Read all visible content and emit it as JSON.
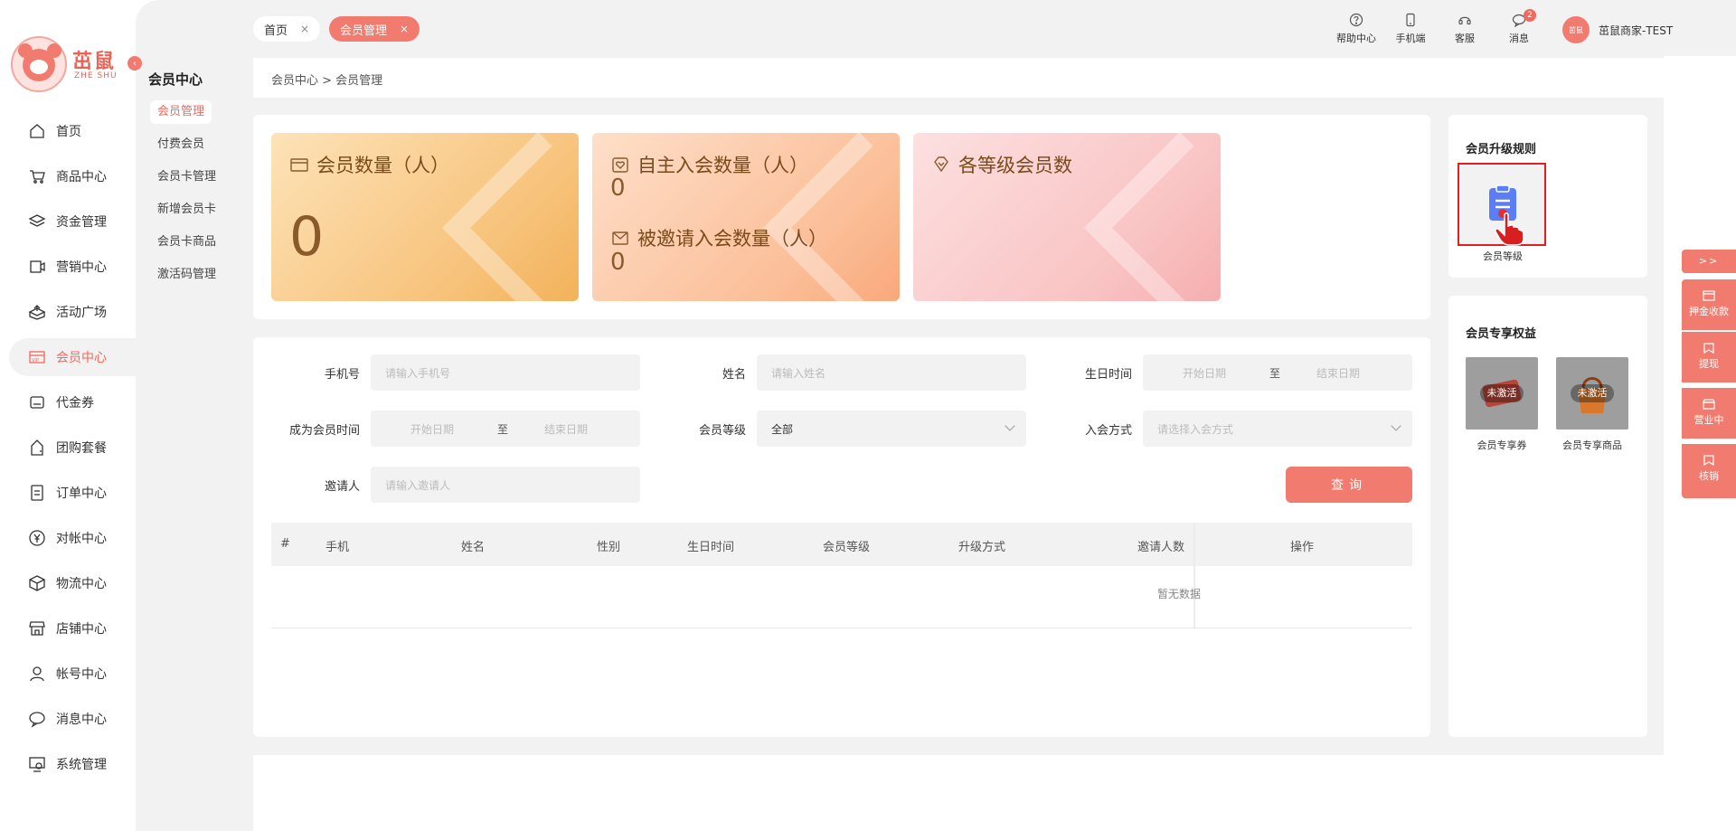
{
  "brand": {
    "name": "茁鼠",
    "sub": "ZHE SHU"
  },
  "nav": [
    {
      "label": "首页",
      "icon": "home-icon"
    },
    {
      "label": "商品中心",
      "icon": "cart-icon"
    },
    {
      "label": "资金管理",
      "icon": "layers-icon"
    },
    {
      "label": "营销中心",
      "icon": "marketing-icon"
    },
    {
      "label": "活动广场",
      "icon": "activity-icon"
    },
    {
      "label": "会员中心",
      "icon": "vip-icon",
      "active": true
    },
    {
      "label": "代金券",
      "icon": "coupon-icon"
    },
    {
      "label": "团购套餐",
      "icon": "group-buy-icon"
    },
    {
      "label": "订单中心",
      "icon": "order-icon"
    },
    {
      "label": "对帐中心",
      "icon": "yen-icon"
    },
    {
      "label": "物流中心",
      "icon": "box-icon"
    },
    {
      "label": "店铺中心",
      "icon": "store-icon"
    },
    {
      "label": "帐号中心",
      "icon": "user-icon"
    },
    {
      "label": "消息中心",
      "icon": "message-icon"
    },
    {
      "label": "系统管理",
      "icon": "system-icon"
    }
  ],
  "subnav": {
    "title": "会员中心",
    "items": [
      "会员管理",
      "付费会员",
      "会员卡管理",
      "新增会员卡",
      "会员卡商品",
      "激活码管理"
    ]
  },
  "tabs": [
    {
      "label": "首页",
      "close": "×"
    },
    {
      "label": "会员管理",
      "close": "×"
    }
  ],
  "toolbar": [
    {
      "label": "帮助中心",
      "icon": "help-icon"
    },
    {
      "label": "手机端",
      "icon": "mobile-icon"
    },
    {
      "label": "客服",
      "icon": "headset-icon"
    },
    {
      "label": "消息",
      "icon": "chat-icon",
      "badge": "2"
    }
  ],
  "user": {
    "name": "茁鼠商家-TEST",
    "avatar_text": "茁鼠"
  },
  "breadcrumb": "会员中心 > 会员管理",
  "stats": {
    "members": {
      "title": "会员数量（人）",
      "value": "0"
    },
    "self_join": {
      "title": "自主入会数量（人）",
      "value": "0"
    },
    "invited": {
      "title": "被邀请入会数量（人）",
      "value": "0"
    },
    "levels": {
      "title": "各等级会员数"
    }
  },
  "upgrade_rules": {
    "title": "会员升级规则",
    "item": "会员等级"
  },
  "benefits": {
    "title": "会员专享权益",
    "items": [
      {
        "label": "会员专享券",
        "status": "未激活"
      },
      {
        "label": "会员专享商品",
        "status": "未激活"
      }
    ]
  },
  "filters": {
    "phone": {
      "label": "手机号",
      "placeholder": "请输入手机号"
    },
    "name": {
      "label": "姓名",
      "placeholder": "请输入姓名"
    },
    "birthday": {
      "label": "生日时间",
      "start": "开始日期",
      "sep": "至",
      "end": "结束日期"
    },
    "member_time": {
      "label": "成为会员时间",
      "start": "开始日期",
      "sep": "至",
      "end": "结束日期"
    },
    "level": {
      "label": "会员等级",
      "value": "全部"
    },
    "join_method": {
      "label": "入会方式",
      "placeholder": "请选择入会方式"
    },
    "inviter": {
      "label": "邀请人",
      "placeholder": "请输入邀请人"
    },
    "query_label": "查询"
  },
  "table": {
    "columns": [
      "#",
      "手机",
      "姓名",
      "性别",
      "生日时间",
      "会员等级",
      "升级方式",
      "邀请人数",
      "操作"
    ],
    "empty": "暂无数据"
  },
  "side_tabs": {
    "expand": ">>",
    "items": [
      "押金收款",
      "提现",
      "营业中",
      "核销"
    ]
  },
  "colors": {
    "accent": "#f27b6f",
    "card1": "#f7c27a",
    "card2": "#fbbf99",
    "card3": "#f9c3c3"
  }
}
